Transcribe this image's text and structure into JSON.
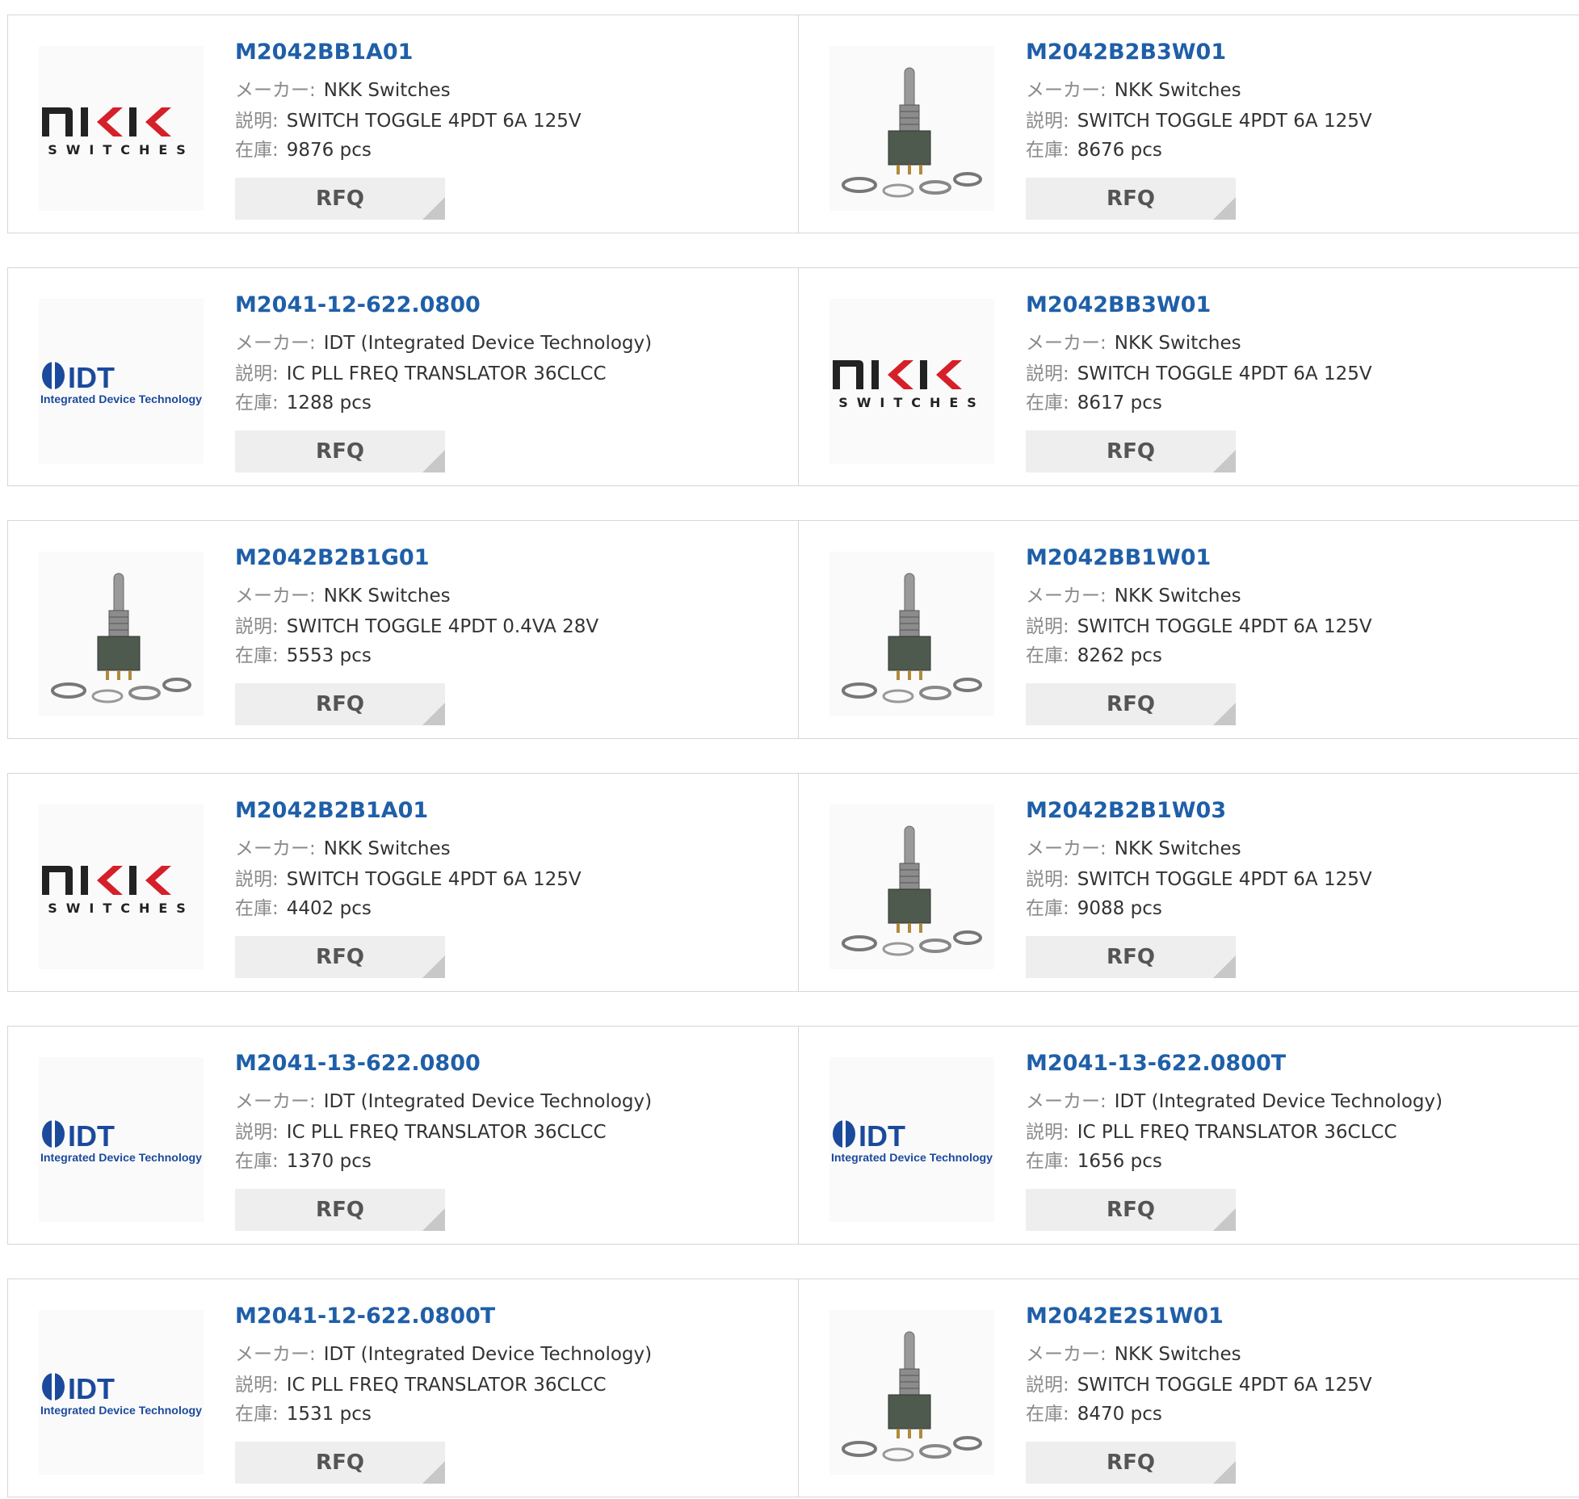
{
  "labels": {
    "maker": "メーカー:",
    "desc": "説明:",
    "stock": "在庫:",
    "rfq": "RFQ"
  },
  "products": [
    {
      "part": "M2042BB1A01",
      "maker": "NKK Switches",
      "desc": "SWITCH TOGGLE 4PDT 6A 125V",
      "stock": "9876 pcs",
      "image": "nkk-logo"
    },
    {
      "part": "M2042B2B3W01",
      "maker": "NKK Switches",
      "desc": "SWITCH TOGGLE 4PDT 6A 125V",
      "stock": "8676 pcs",
      "image": "toggle-switch-photo"
    },
    {
      "part": "M2041-12-622.0800",
      "maker": "IDT (Integrated Device Technology)",
      "desc": "IC PLL FREQ TRANSLATOR 36CLCC",
      "stock": "1288 pcs",
      "image": "idt-logo"
    },
    {
      "part": "M2042BB3W01",
      "maker": "NKK Switches",
      "desc": "SWITCH TOGGLE 4PDT 6A 125V",
      "stock": "8617 pcs",
      "image": "nkk-logo"
    },
    {
      "part": "M2042B2B1G01",
      "maker": "NKK Switches",
      "desc": "SWITCH TOGGLE 4PDT 0.4VA 28V",
      "stock": "5553 pcs",
      "image": "toggle-switch-photo"
    },
    {
      "part": "M2042BB1W01",
      "maker": "NKK Switches",
      "desc": "SWITCH TOGGLE 4PDT 6A 125V",
      "stock": "8262 pcs",
      "image": "toggle-switch-photo"
    },
    {
      "part": "M2042B2B1A01",
      "maker": "NKK Switches",
      "desc": "SWITCH TOGGLE 4PDT 6A 125V",
      "stock": "4402 pcs",
      "image": "nkk-logo"
    },
    {
      "part": "M2042B2B1W03",
      "maker": "NKK Switches",
      "desc": "SWITCH TOGGLE 4PDT 6A 125V",
      "stock": "9088 pcs",
      "image": "toggle-switch-photo"
    },
    {
      "part": "M2041-13-622.0800",
      "maker": "IDT (Integrated Device Technology)",
      "desc": "IC PLL FREQ TRANSLATOR 36CLCC",
      "stock": "1370 pcs",
      "image": "idt-logo"
    },
    {
      "part": "M2041-13-622.0800T",
      "maker": "IDT (Integrated Device Technology)",
      "desc": "IC PLL FREQ TRANSLATOR 36CLCC",
      "stock": "1656 pcs",
      "image": "idt-logo"
    },
    {
      "part": "M2041-12-622.0800T",
      "maker": "IDT (Integrated Device Technology)",
      "desc": "IC PLL FREQ TRANSLATOR 36CLCC",
      "stock": "1531 pcs",
      "image": "idt-logo"
    },
    {
      "part": "M2042E2S1W01",
      "maker": "NKK Switches",
      "desc": "SWITCH TOGGLE 4PDT 6A 125V",
      "stock": "8470 pcs",
      "image": "toggle-switch-photo"
    }
  ],
  "colors": {
    "part_link": "#1f5fa8",
    "nkk_red": "#d5202a",
    "idt_blue": "#1b4a9c",
    "rfq_bg": "#eeeeee"
  }
}
